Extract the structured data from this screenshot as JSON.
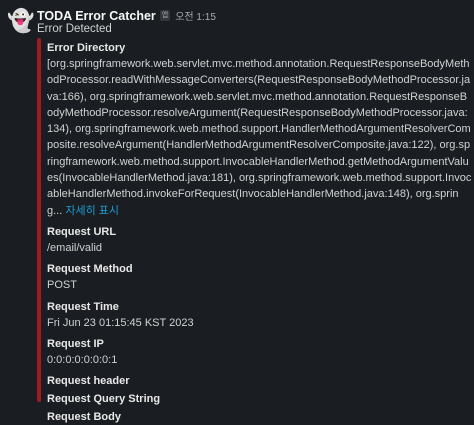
{
  "message": {
    "sender": "TODA Error Catcher",
    "app_badge": "앱",
    "timestamp": "오전 1:15",
    "subtitle": "Error Detected"
  },
  "attachment": {
    "accent_color": "#a01c1c",
    "error_directory": {
      "title": "Error Directory",
      "value": "[org.springframework.web.servlet.mvc.method.annotation.RequestResponseBodyMethodProcessor.readWithMessageConverters(RequestResponseBodyMethodProcessor.java:166), org.springframework.web.servlet.mvc.method.annotation.RequestResponseBodyMethodProcessor.resolveArgument(RequestResponseBodyMethodProcessor.java:134), org.springframework.web.method.support.HandlerMethodArgumentResolverComposite.resolveArgument(HandlerMethodArgumentResolverComposite.java:122), org.springframework.web.method.support.InvocableHandlerMethod.getMethodArgumentValues(InvocableHandlerMethod.java:181), org.springframework.web.method.support.InvocableHandlerMethod.invokeForRequest(InvocableHandlerMethod.java:148), org.spring...",
      "see_more": "자세히 표시"
    },
    "request_url": {
      "title": "Request URL",
      "value": "/email/valid"
    },
    "request_method": {
      "title": "Request Method",
      "value": "POST"
    },
    "request_time": {
      "title": "Request Time",
      "value": "Fri Jun 23 01:15:45 KST 2023"
    },
    "request_ip": {
      "title": "Request IP",
      "value": "0:0:0:0:0:0:0:1"
    },
    "request_header": {
      "title": "Request header"
    },
    "request_query_string": {
      "title": "Request Query String"
    },
    "request_body": {
      "title": "Request Body"
    }
  },
  "icons": {
    "avatar": "ghost-icon"
  }
}
